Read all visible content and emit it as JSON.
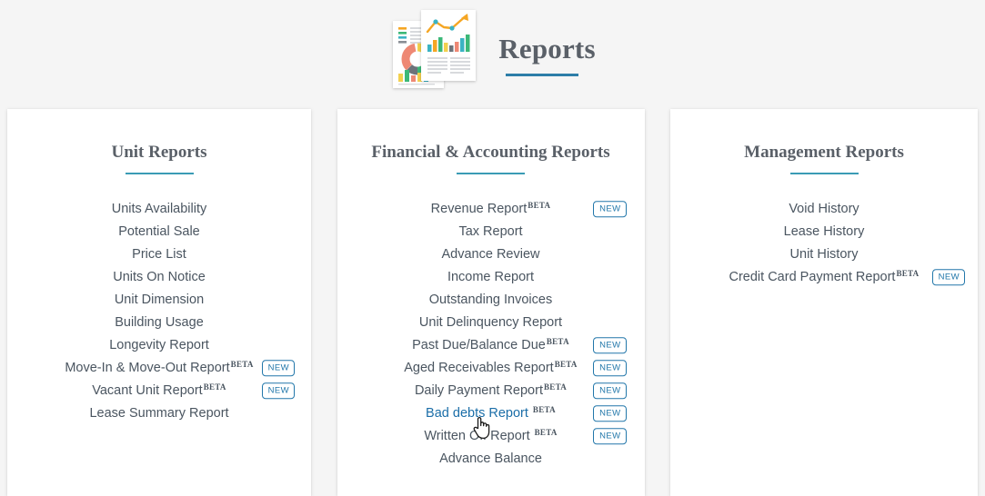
{
  "header": {
    "title": "Reports",
    "icon_name": "reports-documents-icon",
    "accent_color": "#2d7ea8"
  },
  "badges": {
    "beta_label": "BETA",
    "new_label": "NEW",
    "new_color": "#2277aa"
  },
  "cards": [
    {
      "title": "Unit Reports",
      "items": [
        {
          "label": "Units Availability",
          "beta": false,
          "new": false
        },
        {
          "label": "Potential Sale",
          "beta": false,
          "new": false
        },
        {
          "label": "Price List",
          "beta": false,
          "new": false
        },
        {
          "label": "Units On Notice",
          "beta": false,
          "new": false
        },
        {
          "label": "Unit Dimension",
          "beta": false,
          "new": false
        },
        {
          "label": "Building Usage",
          "beta": false,
          "new": false
        },
        {
          "label": "Longevity Report",
          "beta": false,
          "new": false
        },
        {
          "label": "Move-In & Move-Out Report",
          "beta": true,
          "new": true
        },
        {
          "label": "Vacant Unit Report",
          "beta": true,
          "new": true
        },
        {
          "label": "Lease Summary Report",
          "beta": false,
          "new": false
        }
      ]
    },
    {
      "title": "Financial & Accounting Reports",
      "items": [
        {
          "label": "Revenue Report",
          "beta": true,
          "new": true
        },
        {
          "label": "Tax Report",
          "beta": false,
          "new": false
        },
        {
          "label": "Advance Review",
          "beta": false,
          "new": false
        },
        {
          "label": "Income Report",
          "beta": false,
          "new": false
        },
        {
          "label": "Outstanding Invoices",
          "beta": false,
          "new": false
        },
        {
          "label": "Unit Delinquency Report",
          "beta": false,
          "new": false
        },
        {
          "label": "Past Due/Balance Due",
          "beta": true,
          "new": true
        },
        {
          "label": "Aged Receivables Report",
          "beta": true,
          "new": true
        },
        {
          "label": "Daily Payment Report",
          "beta": true,
          "new": true
        },
        {
          "label": "Bad debts Report",
          "beta": true,
          "new": true,
          "hovered": true
        },
        {
          "label": "Written Off Report",
          "beta": true,
          "new": true
        },
        {
          "label": "Advance Balance",
          "beta": false,
          "new": false
        }
      ]
    },
    {
      "title": "Management Reports",
      "items": [
        {
          "label": "Void History",
          "beta": false,
          "new": false
        },
        {
          "label": "Lease History",
          "beta": false,
          "new": false
        },
        {
          "label": "Unit History",
          "beta": false,
          "new": false
        },
        {
          "label": "Credit Card Payment Report",
          "beta": true,
          "new": true
        }
      ]
    }
  ]
}
